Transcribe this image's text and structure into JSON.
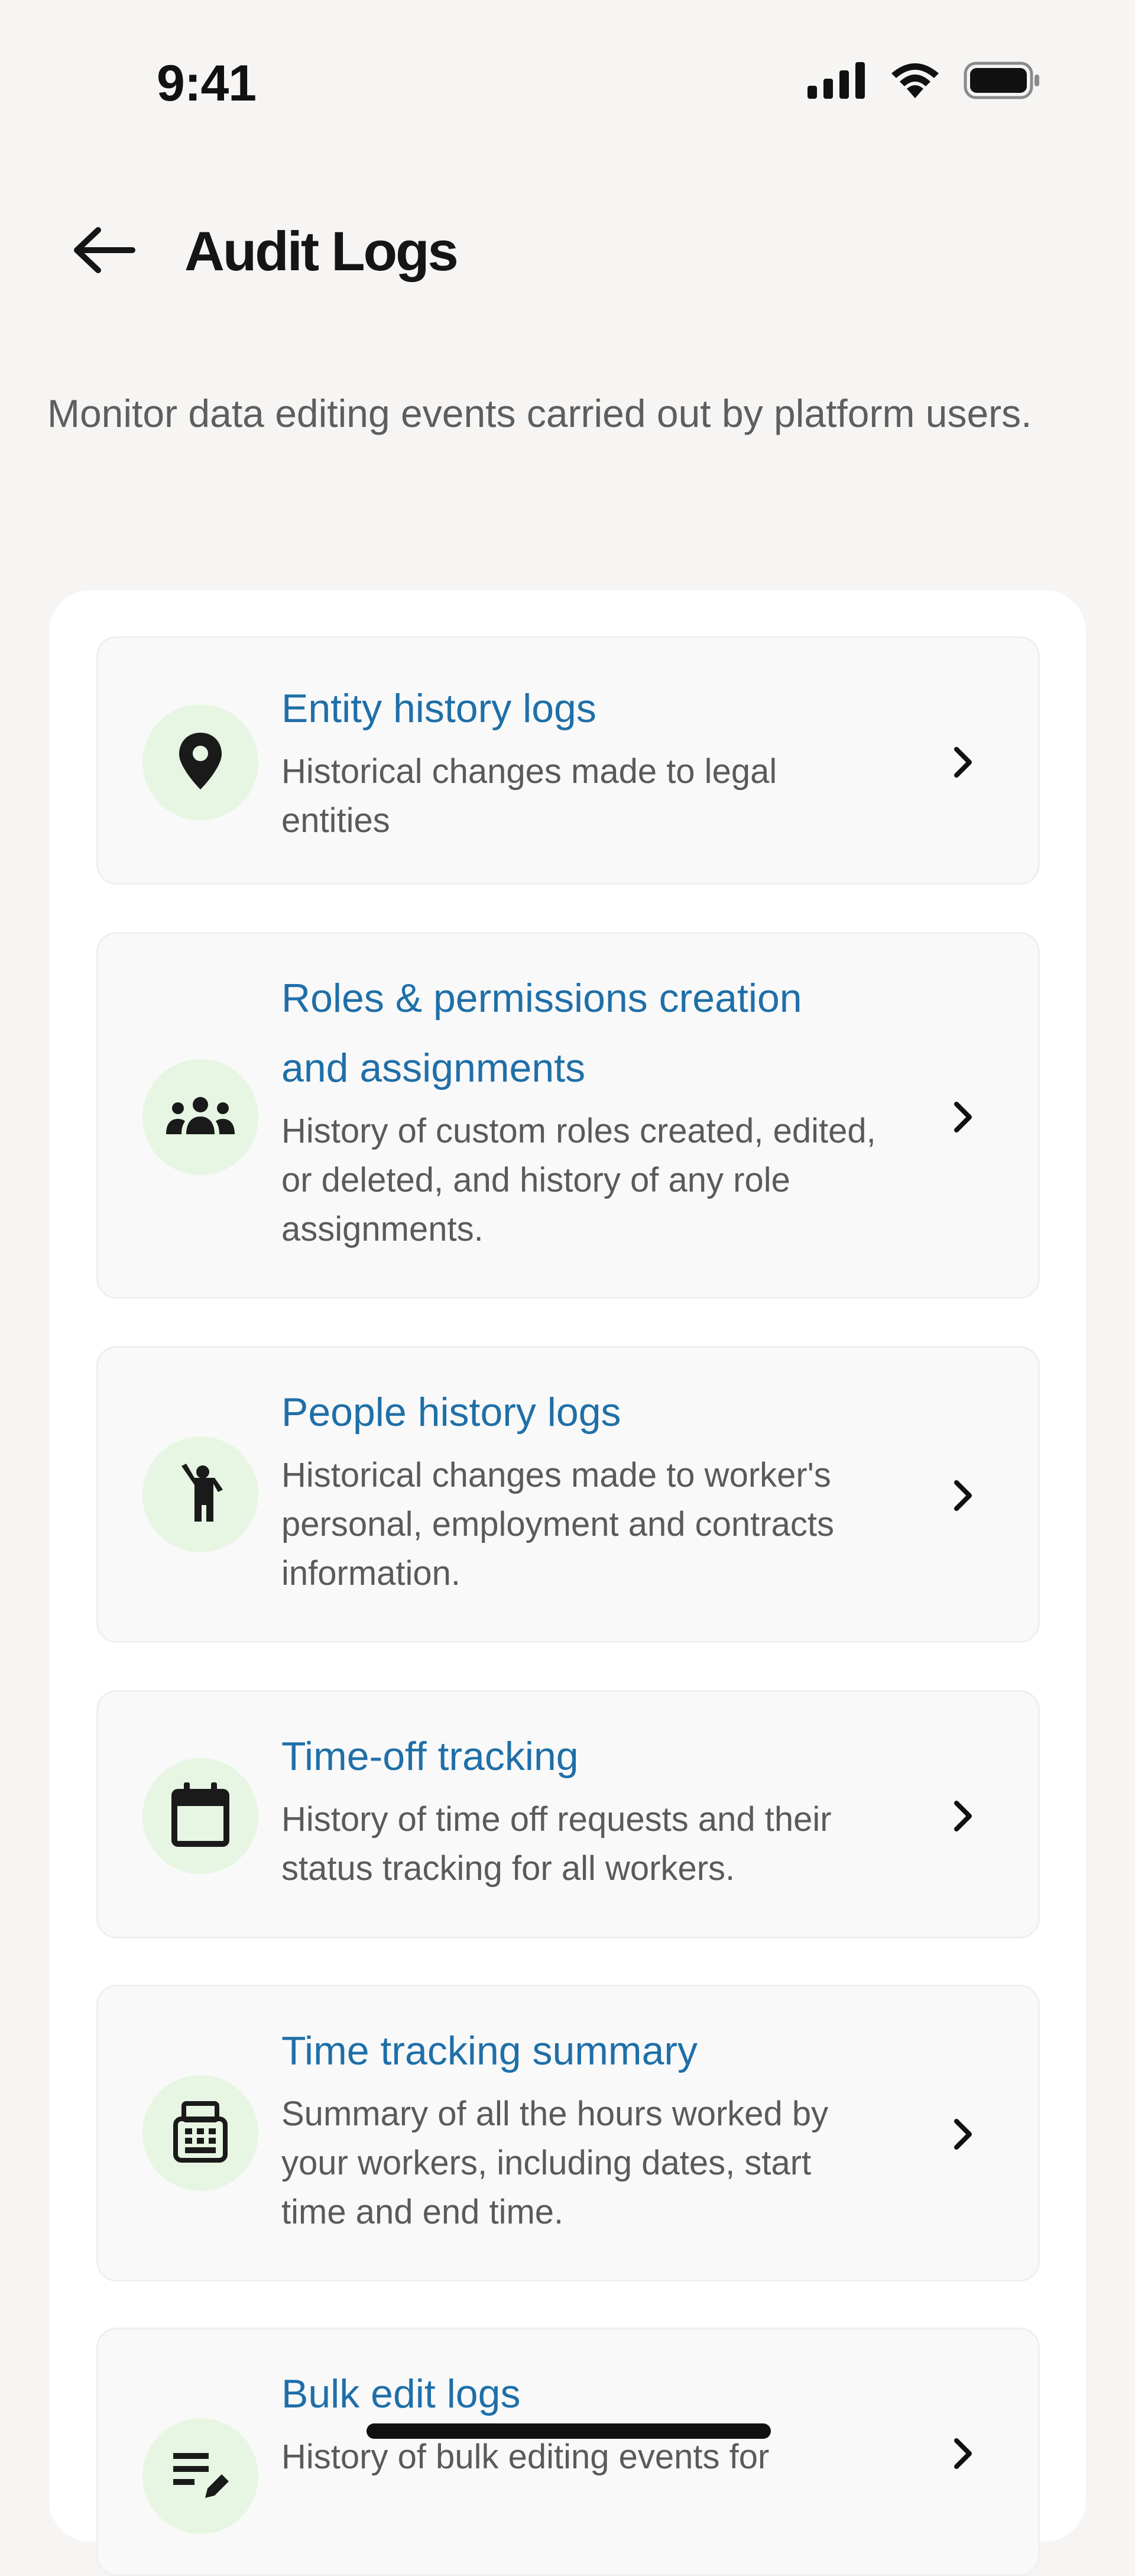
{
  "status_bar": {
    "time": "9:41",
    "icons": [
      "signal-icon",
      "wifi-icon",
      "battery-icon"
    ]
  },
  "header": {
    "back_icon": "arrow-left-icon",
    "title": "Audit Logs"
  },
  "description": "Monitor data editing events carried out by platform users.",
  "colors": {
    "background": "#f6f5f3",
    "card": "#ffffff",
    "item_background": "#f9f9f9",
    "item_title": "#1f6fa8",
    "icon_circle": "#e7f6e3"
  },
  "log_items": [
    {
      "title": "Entity history logs",
      "description": "Historical changes made to legal entities",
      "icon": "location-pin-icon"
    },
    {
      "title": "Roles & permissions creation and assignments",
      "description": "History of custom roles created, edited, or deleted, and history of any role assignments.",
      "icon": "group-icon"
    },
    {
      "title": "People history logs",
      "description": "Historical changes made to worker's personal, employment and contracts information.",
      "icon": "person-waving-icon"
    },
    {
      "title": "Time-off tracking",
      "description": "History of time off requests and their status tracking for all workers.",
      "icon": "calendar-icon"
    },
    {
      "title": "Time tracking summary",
      "description": "Summary of all the hours worked by your workers, including dates, start time and end time.",
      "icon": "calculator-icon"
    },
    {
      "title": "Bulk edit logs",
      "description": "History of bulk editing events for",
      "icon": "edit-list-icon"
    }
  ]
}
